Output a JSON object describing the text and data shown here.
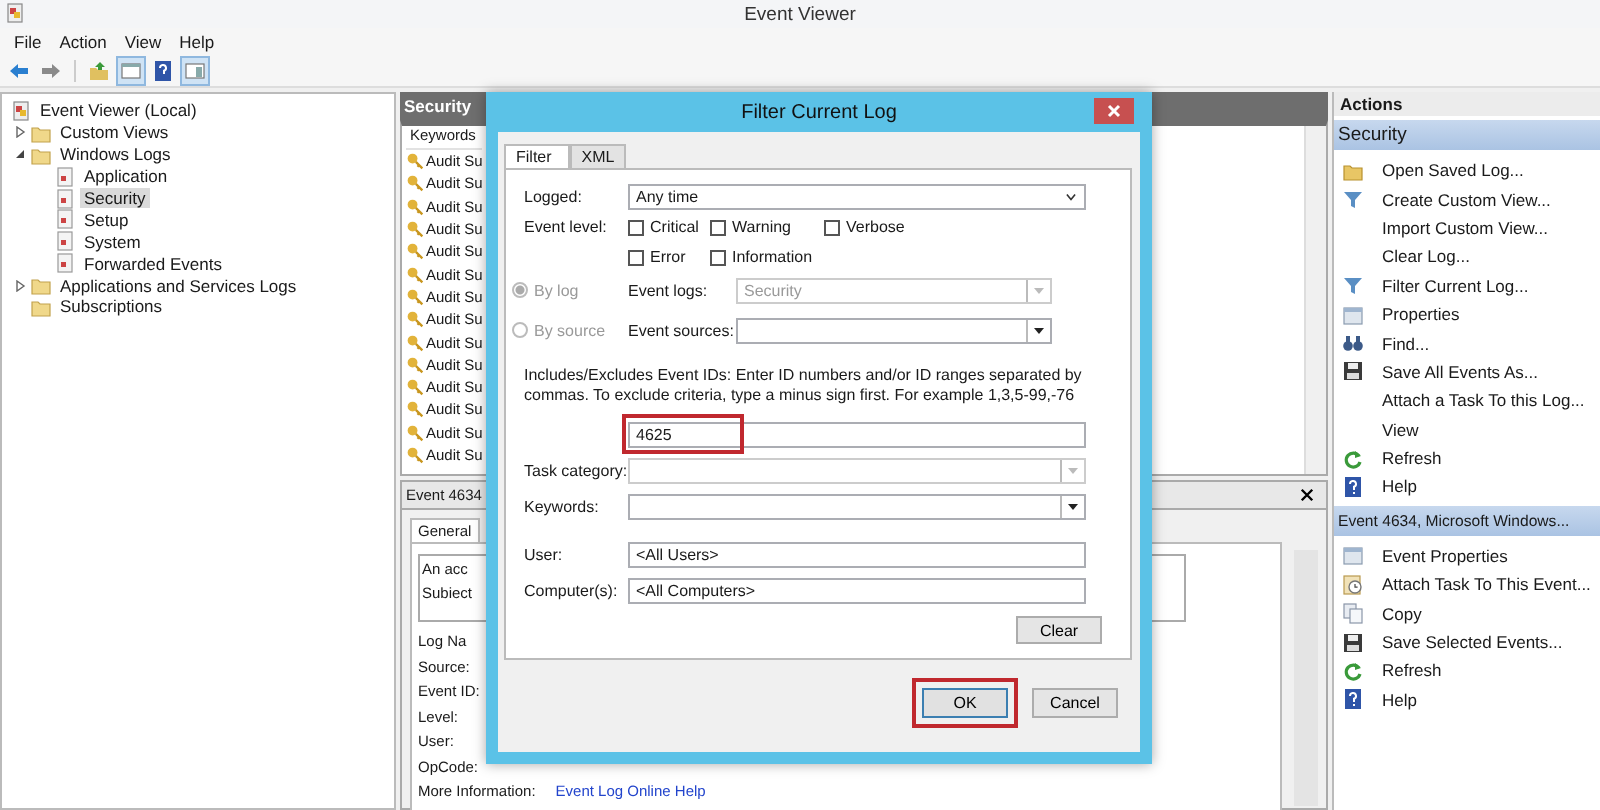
{
  "window": {
    "title": "Event Viewer"
  },
  "menu": [
    "File",
    "Action",
    "View",
    "Help"
  ],
  "tree": [
    {
      "label": "Event Viewer (Local)",
      "selected": false,
      "children": [
        {
          "label": "Custom Views",
          "expanded": false,
          "selected": false
        },
        {
          "label": "Windows Logs",
          "expanded": true,
          "selected": false,
          "children": [
            {
              "label": "Application",
              "selected": false
            },
            {
              "label": "Security",
              "selected": true
            },
            {
              "label": "Setup",
              "selected": false
            },
            {
              "label": "System",
              "selected": false
            },
            {
              "label": "Forwarded Events",
              "selected": false
            }
          ]
        },
        {
          "label": "Applications and Services Logs",
          "expanded": false,
          "selected": false
        },
        {
          "label": "Subscriptions",
          "selected": false
        }
      ]
    }
  ],
  "log_pane": {
    "title": "Security",
    "column": "Keywords",
    "rows": [
      "Audit Su",
      "Audit Su",
      "Audit Su",
      "Audit Su",
      "Audit Su",
      "Audit Su",
      "Audit Su",
      "Audit Su",
      "Audit Su",
      "Audit Su",
      "Audit Su",
      "Audit Su",
      "Audit Su",
      "Audit Su"
    ]
  },
  "detail_pane": {
    "title": "Event 4634",
    "tabs": [
      {
        "label": "General",
        "selected": true
      }
    ],
    "description": [
      "An acc",
      "Subiect"
    ],
    "fields": [
      "Log Na",
      "Source:",
      "Event ID:",
      "Level:",
      "User:",
      "OpCode:",
      "More Information:"
    ],
    "link": "Event Log Online Help"
  },
  "dialog": {
    "title": "Filter Current Log",
    "tabs": [
      {
        "label": "Filter",
        "selected": true
      },
      {
        "label": "XML",
        "selected": false
      }
    ],
    "logged": {
      "label": "Logged:",
      "value": "Any time"
    },
    "event_level": {
      "label": "Event level:",
      "options": [
        {
          "label": "Critical",
          "checked": false
        },
        {
          "label": "Warning",
          "checked": false
        },
        {
          "label": "Verbose",
          "checked": false
        },
        {
          "label": "Error",
          "checked": false
        },
        {
          "label": "Information",
          "checked": false
        }
      ]
    },
    "source_mode": [
      {
        "label": "By log",
        "selected": true,
        "disabled": true
      },
      {
        "label": "By source",
        "selected": false,
        "disabled": true
      }
    ],
    "event_logs": {
      "label": "Event logs:",
      "value": "Security",
      "disabled": true
    },
    "event_sources": {
      "label": "Event sources:",
      "disabled": false
    },
    "id_help": "Includes/Excludes Event IDs: Enter ID numbers and/or ID ranges separated by commas. To exclude criteria, type a minus sign first. For example 1,3,5-99,-76",
    "event_ids": {
      "value": "4625",
      "highlighted": true
    },
    "task_category": {
      "label": "Task category:",
      "disabled": true
    },
    "keywords": {
      "label": "Keywords:",
      "disabled": false
    },
    "user": {
      "label": "User:",
      "value": "<All Users>"
    },
    "computers": {
      "label": "Computer(s):",
      "value": "<All Computers>"
    },
    "clear_button": "Clear",
    "buttons": [
      {
        "label": "OK",
        "highlighted": true
      },
      {
        "label": "Cancel"
      }
    ]
  },
  "actions": {
    "header": "Actions",
    "sections": [
      {
        "title": "Security",
        "items": [
          "Open Saved Log...",
          "Create Custom View...",
          "Import Custom View...",
          "Clear Log...",
          "Filter Current Log...",
          "Properties",
          "Find...",
          "Save All Events As...",
          "Attach a Task To this Log...",
          "View",
          "Refresh",
          "Help"
        ]
      },
      {
        "title": "Event 4634, Microsoft Windows...",
        "items": [
          "Event Properties",
          "Attach Task To This Event...",
          "Copy",
          "Save Selected Events...",
          "Refresh",
          "Help"
        ]
      }
    ]
  }
}
